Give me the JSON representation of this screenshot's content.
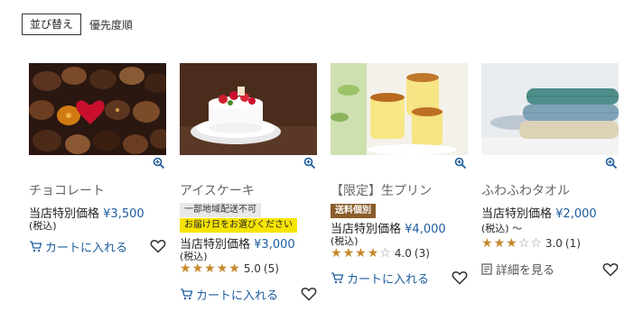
{
  "sort": {
    "button_label": "並び替え",
    "value": "優先度順"
  },
  "products": [
    {
      "name": "チョコレート",
      "price_label": "当店特別価格",
      "price": "¥3,500",
      "tax": "(税込)",
      "cart_label": "カートに入れる"
    },
    {
      "name": "アイスケーキ",
      "badges": [
        "一部地域配送不可",
        "お届け日をお選びください"
      ],
      "price_label": "当店特別価格",
      "price": "¥3,000",
      "tax": "(税込)",
      "rating": 5.0,
      "rating_text": "5.0",
      "review_count": "(5)",
      "cart_label": "カートに入れる"
    },
    {
      "name": "【限定】生プリン",
      "badges": [
        "送料個別"
      ],
      "price_label": "当店特別価格",
      "price": "¥4,000",
      "tax": "(税込)",
      "rating": 4.0,
      "rating_text": "4.0",
      "review_count": "(3)",
      "cart_label": "カートに入れる"
    },
    {
      "name": "ふわふわタオル",
      "price_label": "当店特別価格",
      "price": "¥2,000",
      "tax": "(税込) 〜",
      "rating": 3.0,
      "rating_text": "3.0",
      "review_count": "(1)",
      "details_label": "詳細を見る"
    }
  ],
  "colors": {
    "link": "#1d5c9e",
    "star": "#c8882b",
    "badge_yellow": "#f7e400",
    "badge_brown": "#8a5d2b"
  }
}
